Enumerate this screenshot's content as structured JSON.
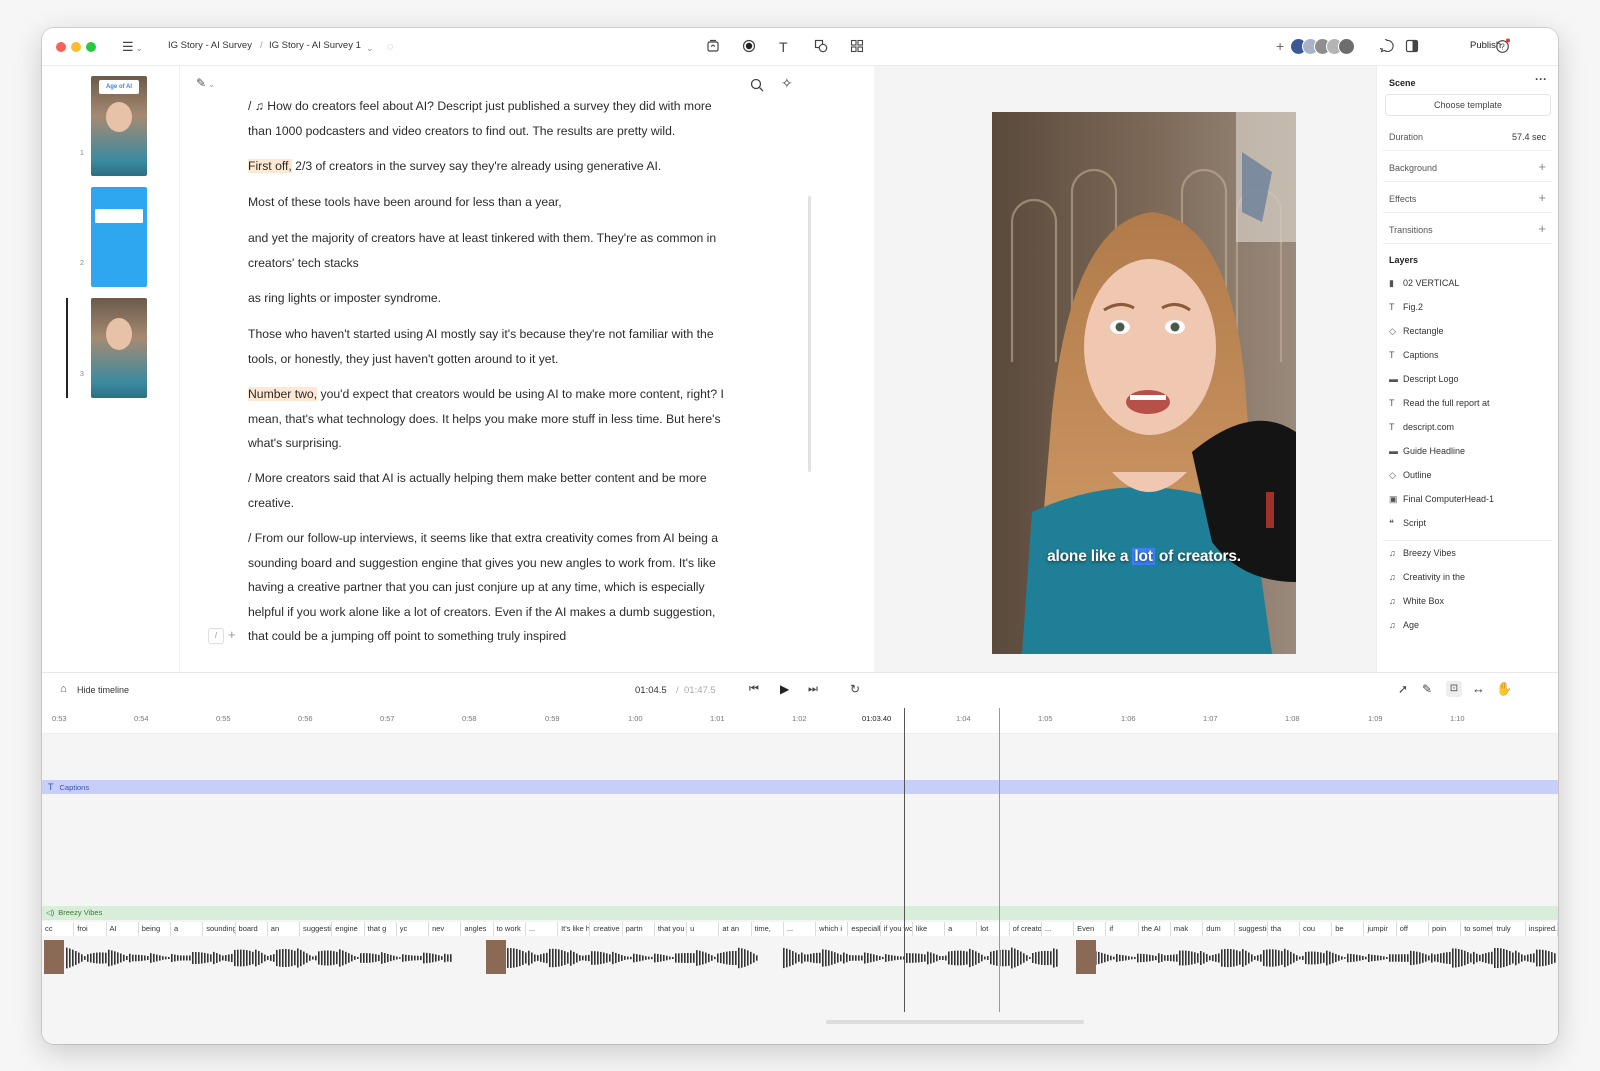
{
  "app": {
    "breadcrumb_project": "IG Story - AI Survey",
    "breadcrumb_sep": "/",
    "breadcrumb_composition": "IG Story - AI Survey 1",
    "publish_label": "Publish"
  },
  "scenes": [
    {
      "number": "1",
      "thumb_title": "Age of AI"
    },
    {
      "number": "2"
    },
    {
      "number": "3"
    }
  ],
  "script": {
    "paragraphs": [
      {
        "lines": [
          "/ ♫  How do creators feel about AI? Descript just published a survey they did with more",
          "than 1000 podcasters and video creators to find out. The results are pretty wild."
        ]
      },
      {
        "hl": "First off,",
        "lines": [
          " 2/3 of creators in the survey say they're already using generative AI."
        ]
      },
      {
        "lines": [
          "Most of these tools have been around for less than a year,"
        ]
      },
      {
        "lines": [
          "and yet the majority of creators have at least tinkered with them. They're as common in",
          "creators' tech stacks"
        ]
      },
      {
        "lines": [
          "as ring lights or imposter syndrome."
        ]
      },
      {
        "lines": [
          "Those who haven't started using AI mostly say it's because they're not familiar with the",
          "tools, or honestly, they just haven't gotten around to it yet."
        ]
      },
      {
        "hl": "Number two,",
        "lines": [
          " you'd expect that creators would be using AI to make more content, right? I",
          "mean, that's what technology does. It helps you make more stuff in less time. But here's",
          "what's surprising."
        ]
      },
      {
        "lines": [
          "/ More creators said that AI is actually helping them make better content and be more",
          "creative."
        ]
      },
      {
        "lines": [
          "/ From our follow-up interviews, it seems like that extra creativity comes from AI being a",
          "sounding board and suggestion engine that gives you new angles to work from. It's like",
          "having a creative partner that you can just conjure up at any time, which is especially",
          "helpful if you work alone like a lot of creators. Even if the AI makes a dumb suggestion,",
          "that could be a jumping off point to something truly inspired"
        ]
      }
    ]
  },
  "preview": {
    "caption_before": "alone like a ",
    "caption_highlight": "lot",
    "caption_after": " of creators."
  },
  "properties": {
    "scene_title": "Scene",
    "choose_template": "Choose template",
    "duration_label": "Duration",
    "duration_value": "57.4 sec",
    "background_label": "Background",
    "effects_label": "Effects",
    "transitions_label": "Transitions",
    "layers_title": "Layers",
    "layers": [
      {
        "icon": "▮",
        "name": "02 VERTICAL"
      },
      {
        "icon": "T",
        "name": "Fig.2"
      },
      {
        "icon": "◇",
        "name": "Rectangle"
      },
      {
        "icon": "T",
        "name": "Captions"
      },
      {
        "icon": "▬",
        "name": "Descript Logo"
      },
      {
        "icon": "T",
        "name": "Read the full report at"
      },
      {
        "icon": "T",
        "name": "descript.com"
      },
      {
        "icon": "▬",
        "name": "Guide Headline"
      },
      {
        "icon": "◇",
        "name": "Outline"
      },
      {
        "icon": "▣",
        "name": "Final ComputerHead-1"
      },
      {
        "icon": "❝",
        "name": "Script"
      }
    ],
    "audio_layers": [
      {
        "icon": "♫",
        "name": "Breezy Vibes"
      },
      {
        "icon": "♫",
        "name": "Creativity in the"
      },
      {
        "icon": "♫",
        "name": "White Box"
      },
      {
        "icon": "♫",
        "name": "Age"
      }
    ]
  },
  "timeline": {
    "hide_label": "Hide timeline",
    "current_time": "01:04.5",
    "separator": "/",
    "total_time": "01:47.5",
    "ticks": [
      "0:53",
      "0:54",
      "0:55",
      "0:56",
      "0:57",
      "0:58",
      "0:59",
      "1:00",
      "1:01",
      "1:02",
      "01:03.40",
      "1:04",
      "1:05",
      "1:06",
      "1:07",
      "1:08",
      "1:09",
      "1:10"
    ],
    "caption_track": "Captions",
    "music_track": "Breezy Vibes",
    "words": [
      "cc",
      "froi",
      "AI",
      "being",
      "a",
      "sounding",
      "board",
      "an",
      "suggestion",
      "engine",
      "that g",
      "yc",
      "nev",
      "angles",
      "to work",
      "...",
      "It's like hav",
      "creative",
      "partn",
      "that you can just coi",
      "u",
      "at an",
      "time,",
      "...",
      "which i",
      "especially helpf",
      "if you work alone,",
      "like",
      "a",
      "lot",
      "of creators.",
      "...",
      "Even",
      "if",
      "the AI",
      "mak",
      "dum",
      "suggestion,",
      "tha",
      "cou",
      "be",
      "jumpir",
      "off",
      "poin",
      "to somet",
      "truly",
      "inspired."
    ]
  },
  "colors": {
    "accent": "#3b82f6",
    "caption_track": "#c7cff8",
    "music_track": "#d9eed8",
    "highlight": "#fde8d4"
  }
}
